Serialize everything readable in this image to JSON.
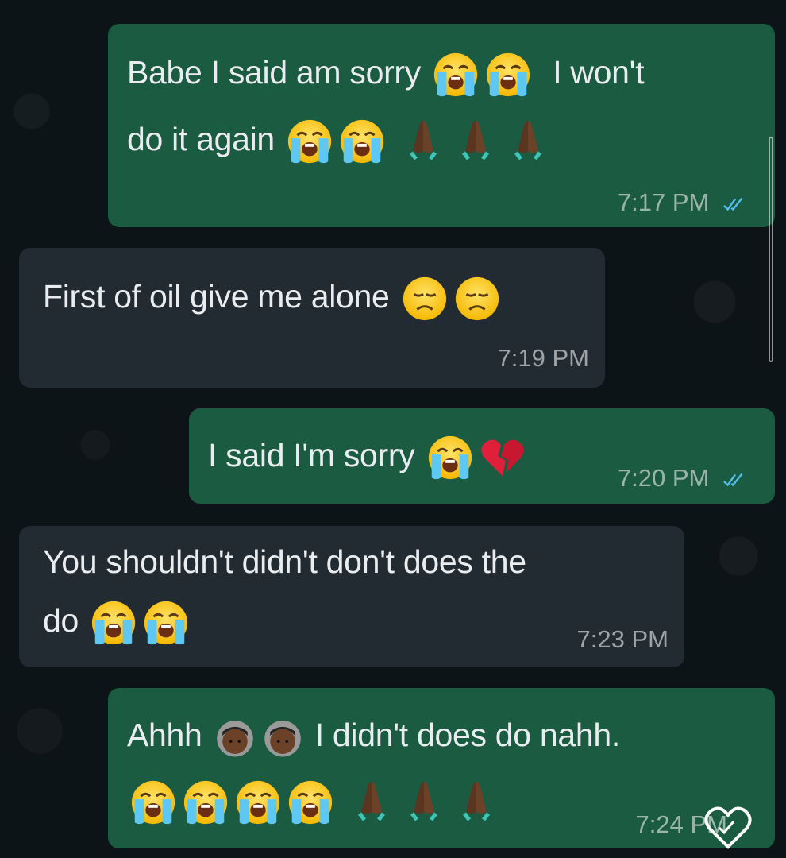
{
  "messages": [
    {
      "direction": "outgoing",
      "text_1": "Babe  I said am sorry",
      "text_2": "I won't",
      "text_3": "do it again",
      "time": "7:17 PM",
      "status": "read",
      "emojis": [
        "loudly-crying",
        "loudly-crying",
        "loudly-crying",
        "loudly-crying",
        "folded-hands",
        "folded-hands",
        "folded-hands"
      ]
    },
    {
      "direction": "incoming",
      "text_1": "First of oil give me alone",
      "time": "7:19 PM",
      "emojis": [
        "disappointed-face",
        "disappointed-face"
      ]
    },
    {
      "direction": "outgoing",
      "text_1": "I said I'm sorry",
      "time": "7:20 PM",
      "status": "read",
      "emojis": [
        "loudly-crying",
        "broken-heart"
      ]
    },
    {
      "direction": "incoming",
      "text_1": "You shouldn't didn't don't does the",
      "text_2": "do",
      "time": "7:23 PM",
      "emojis": [
        "loudly-crying",
        "loudly-crying"
      ]
    },
    {
      "direction": "outgoing",
      "text_1": "Ahhh",
      "text_2": "I didn't does do nahh.",
      "time": "7:24 PM",
      "status": "read",
      "emojis": [
        "person-with-crown",
        "person-with-crown",
        "loudly-crying",
        "loudly-crying",
        "loudly-crying",
        "loudly-crying",
        "folded-hands",
        "folded-hands",
        "folded-hands"
      ]
    }
  ],
  "colors": {
    "outgoing_bubble": "#1a5b41",
    "incoming_bubble": "#222b31",
    "read_ticks": "#53bdeb",
    "background": "#0d1418"
  },
  "icons": [
    "double-check-icon",
    "scrollbar",
    "heart-reaction-icon"
  ]
}
